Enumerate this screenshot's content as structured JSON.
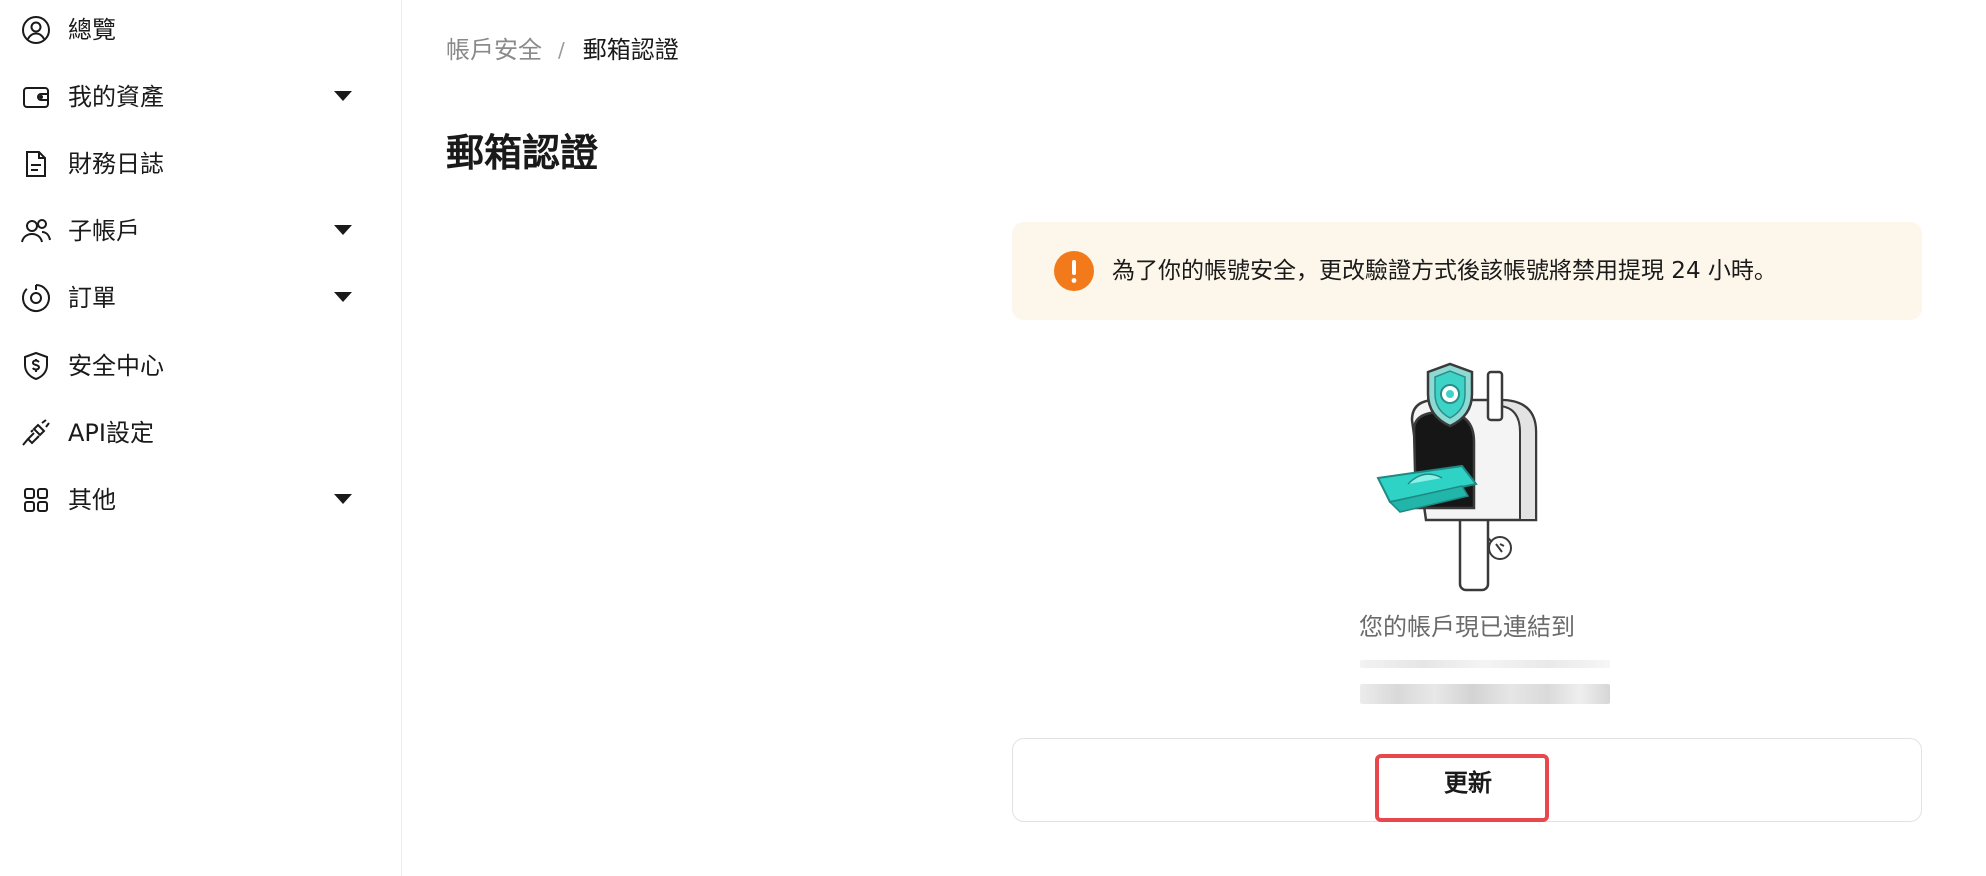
{
  "sidebar": {
    "items": [
      {
        "label": "總覽",
        "icon": "user-circle-icon",
        "has_dropdown": false
      },
      {
        "label": "我的資產",
        "icon": "wallet-icon",
        "has_dropdown": true
      },
      {
        "label": "財務日誌",
        "icon": "document-icon",
        "has_dropdown": false
      },
      {
        "label": "子帳戶",
        "icon": "users-icon",
        "has_dropdown": true
      },
      {
        "label": "訂單",
        "icon": "target-icon",
        "has_dropdown": true
      },
      {
        "label": "安全中心",
        "icon": "shield-dollar-icon",
        "has_dropdown": false
      },
      {
        "label": "API設定",
        "icon": "api-plug-icon",
        "has_dropdown": false
      },
      {
        "label": "其他",
        "icon": "grid-icon",
        "has_dropdown": true
      }
    ]
  },
  "breadcrumb": {
    "parent": "帳戶安全",
    "separator": "/",
    "current": "郵箱認證"
  },
  "main": {
    "title": "郵箱認證",
    "warning": {
      "icon": "exclamation-icon",
      "text": "為了你的帳號安全，更改驗證方式後該帳號將禁用提現 24 小時。"
    },
    "illustration": "mailbox-illustration",
    "linked_text": "您的帳戶現已連結到",
    "update_label": "更新"
  },
  "colors": {
    "warning_bg": "#fdf6ea",
    "warning_icon": "#f27a1a",
    "highlight_border": "#e8474e",
    "text_primary": "#1a1a1a",
    "text_secondary": "#6b6b6b",
    "accent_teal": "#2fd3c6"
  }
}
